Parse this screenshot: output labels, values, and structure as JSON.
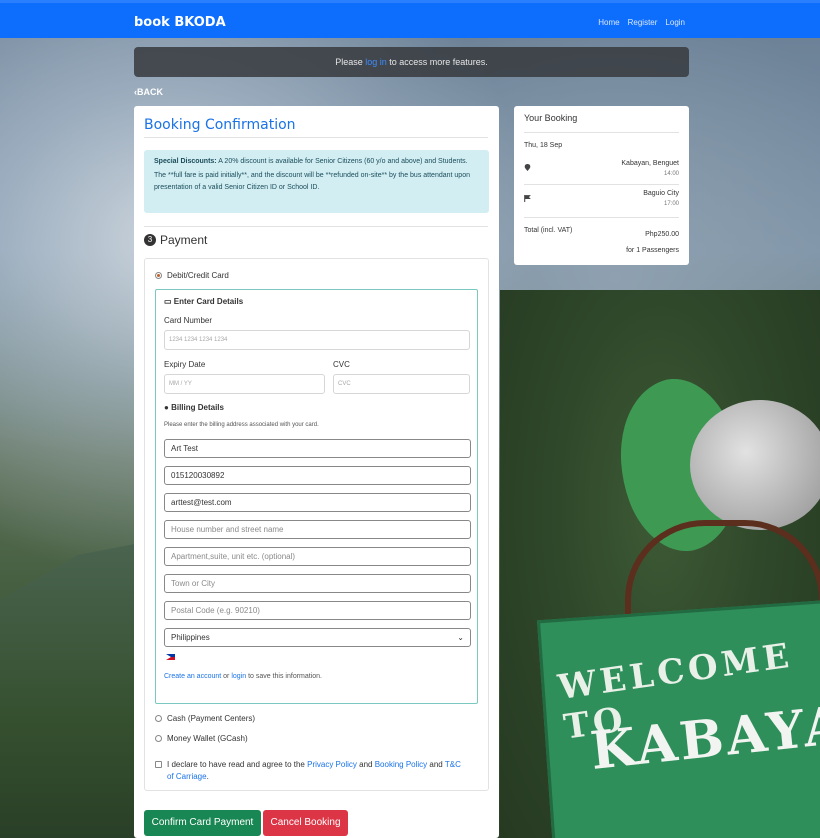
{
  "navbar": {
    "brand": "book BKODA",
    "links": [
      "Home",
      "Register",
      "Login"
    ]
  },
  "notice": {
    "pre": "Please ",
    "link": "log in",
    "post": " to access more features."
  },
  "back_label": "BACK",
  "booking": {
    "title": "Booking Confirmation",
    "discount_label": "Special Discounts:",
    "discount_text": " A 20% discount is available for Senior Citizens (60 y/o and above) and Students.",
    "fare_note": "The **full fare is paid initially**, and the discount will be **refunded on-site** by the bus attendant upon presentation of a valid Senior Citizen ID or School ID.",
    "step_number": "3",
    "payment_heading": "Payment",
    "methods": {
      "card": "Debit/Credit Card",
      "cash": "Cash (Payment Centers)",
      "wallet": "Money Wallet (GCash)"
    },
    "card_details": {
      "heading": "Enter Card Details",
      "card_number_label": "Card Number",
      "card_number_placeholder": "1234 1234 1234 1234",
      "expiry_label": "Expiry Date",
      "expiry_placeholder": "MM / YY",
      "cvc_label": "CVC",
      "cvc_placeholder": "CVC"
    },
    "billing": {
      "heading": "Billing Details",
      "hint": "Please enter the billing address associated with your card.",
      "name": "Art Test",
      "phone": "015120030892",
      "email": "arttest@test.com",
      "street_placeholder": "House number and street name",
      "apt_placeholder": "Apartment,suite, unit etc. (optional)",
      "town_placeholder": "Town or City",
      "postal_placeholder": "Postal Code (e.g. 90210)",
      "country": "Philippines",
      "save_link1": "Create an account",
      "save_or": " or ",
      "save_link2": "login",
      "save_post": " to save this information."
    },
    "agree": {
      "pre": "I declare to have read and agree to the ",
      "privacy": "Privacy Policy",
      "and1": " and ",
      "booking": "Booking Policy",
      "and2": " and ",
      "tc": "T&C of Carriage",
      "end": "."
    },
    "confirm_button": "Confirm Card Payment",
    "cancel_button": "Cancel Booking"
  },
  "summary": {
    "title": "Your Booking",
    "date": "Thu, 18 Sep",
    "origin": "Kabayan, Benguet",
    "origin_time": "14:00",
    "destination": "Baguio City",
    "destination_time": "17:00",
    "total_label": "Total (incl. VAT)",
    "total_value": "Php250.00",
    "passengers": "for 1 Passengers"
  },
  "background_sign": {
    "line1": "WELCOME TO",
    "line2": "KABAYAN"
  },
  "colors": {
    "primary": "#0d6efd",
    "success": "#198754",
    "danger": "#dc3545",
    "info_bg": "#d2eef3"
  }
}
